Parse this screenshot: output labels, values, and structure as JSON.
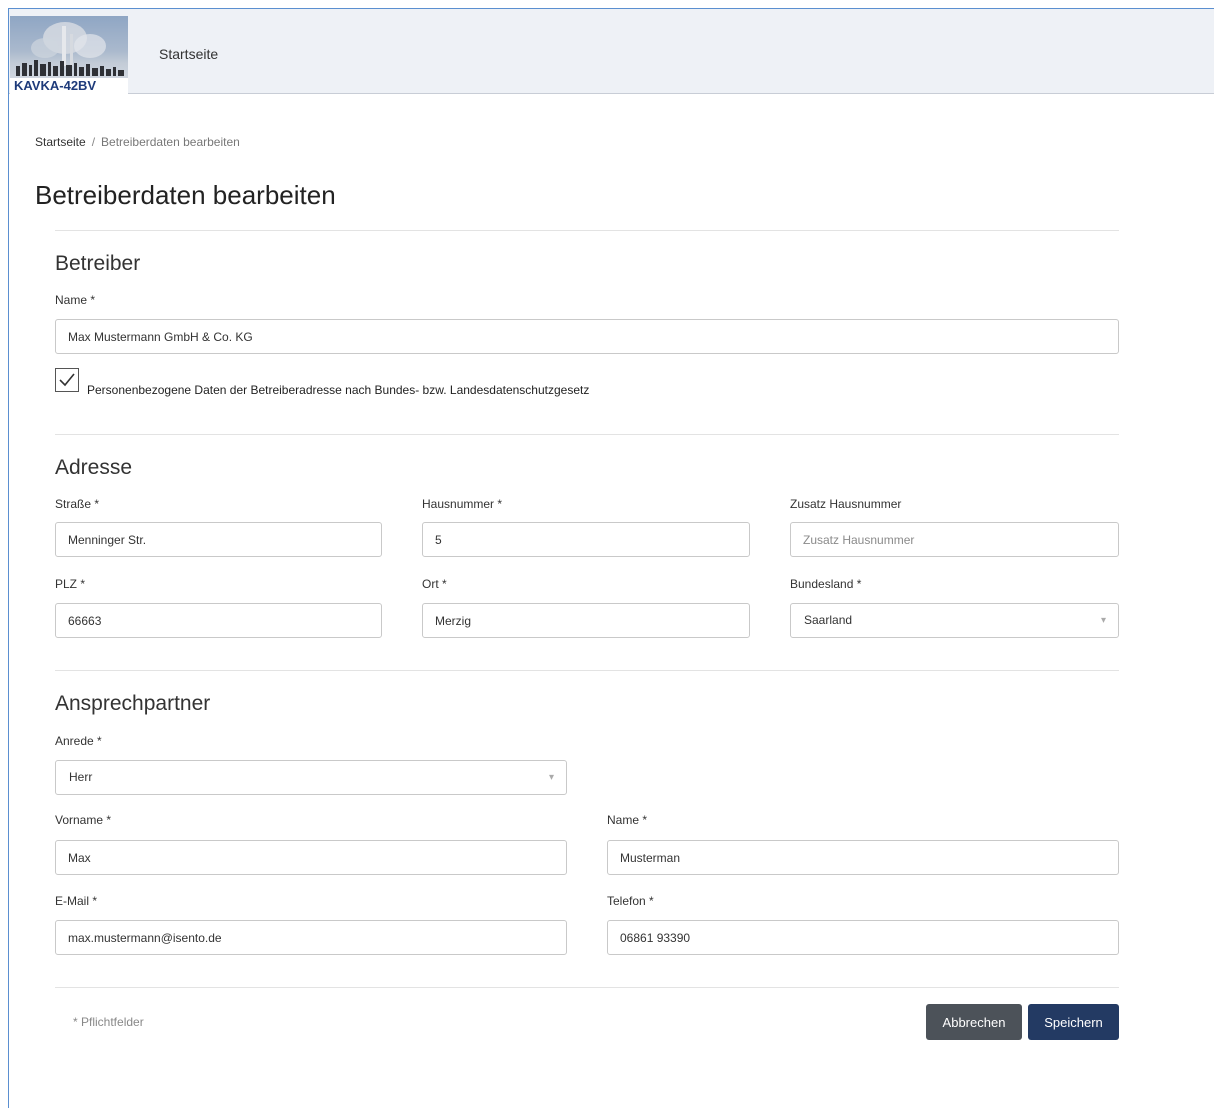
{
  "header": {
    "logo_text": "KAVKA-42BV",
    "nav_home": "Startseite"
  },
  "breadcrumb": {
    "home": "Startseite",
    "separator": "/",
    "current": "Betreiberdaten bearbeiten"
  },
  "page_title": "Betreiberdaten bearbeiten",
  "betreiber": {
    "title": "Betreiber",
    "name_label": "Name *",
    "name_value": "Max Mustermann GmbH & Co. KG",
    "privacy_checked": true,
    "privacy_label": "Personenbezogene Daten der Betreiberadresse nach Bundes- bzw. Landesdatenschutzgesetz"
  },
  "adresse": {
    "title": "Adresse",
    "strasse_label": "Straße *",
    "strasse_value": "Menninger Str.",
    "hausnummer_label": "Hausnummer *",
    "hausnummer_value": "5",
    "zusatz_label": "Zusatz Hausnummer",
    "zusatz_placeholder": "Zusatz Hausnummer",
    "plz_label": "PLZ *",
    "plz_value": "66663",
    "ort_label": "Ort *",
    "ort_value": "Merzig",
    "bundesland_label": "Bundesland *",
    "bundesland_value": "Saarland"
  },
  "ansprechpartner": {
    "title": "Ansprechpartner",
    "anrede_label": "Anrede *",
    "anrede_value": "Herr",
    "vorname_label": "Vorname *",
    "vorname_value": "Max",
    "name_label": "Name *",
    "name_value": "Musterman",
    "email_label": "E-Mail *",
    "email_value": "max.mustermann@isento.de",
    "telefon_label": "Telefon *",
    "telefon_value": "06861 93390"
  },
  "footer": {
    "required_note": "* Pflichtfelder",
    "cancel_label": "Abbrechen",
    "save_label": "Speichern"
  },
  "colors": {
    "save_button": "#233a63",
    "cancel_button": "#4c5259",
    "logo_text": "#1d3a7a"
  },
  "icons": {
    "select_caret": "chevron-down-icon",
    "checkbox": "checkmark-icon"
  }
}
